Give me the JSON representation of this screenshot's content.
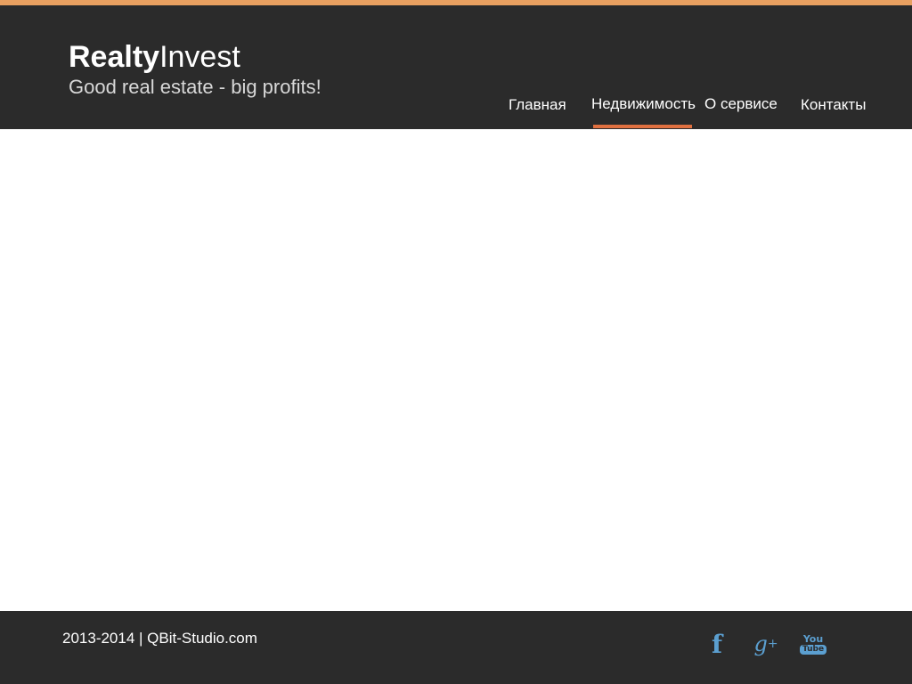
{
  "brand": {
    "name_bold": "Realty",
    "name_light": "Invest",
    "tagline": "Good real estate - big profits!"
  },
  "nav": {
    "items": [
      {
        "label": "Главная",
        "active": false
      },
      {
        "label": "Недвижимость",
        "active": true
      },
      {
        "label": "О сервисе",
        "active": false
      },
      {
        "label": "Контакты",
        "active": false
      }
    ]
  },
  "footer": {
    "copyright": "2013-2014 | QBit-Studio.com",
    "social": {
      "facebook_glyph": "f",
      "gplus_glyph": "g",
      "gplus_plus": "+",
      "youtube_top": "You",
      "youtube_bottom": "Tube"
    }
  },
  "colors": {
    "accent_bar": "#e8a060",
    "header_bg": "#2b2b2b",
    "active_underline": "#e07040",
    "social_icon": "#5b9fd0"
  },
  "icons": [
    "facebook-icon",
    "google-plus-icon",
    "youtube-icon"
  ]
}
